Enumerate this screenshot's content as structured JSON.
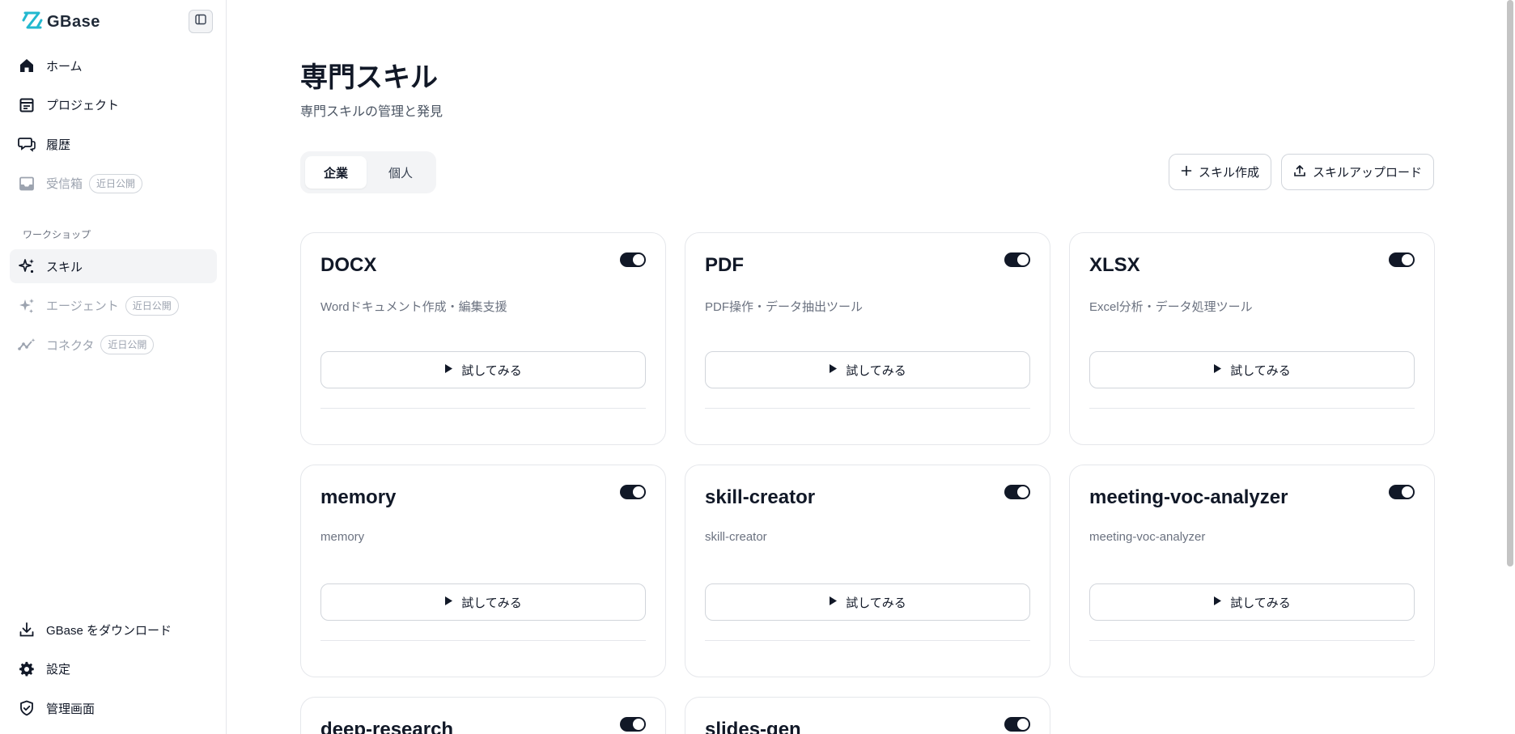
{
  "brand": {
    "name": "GBase"
  },
  "sidebar": {
    "items": [
      {
        "label": "ホーム",
        "icon": "home-icon"
      },
      {
        "label": "プロジェクト",
        "icon": "project-icon"
      },
      {
        "label": "履歴",
        "icon": "history-icon"
      },
      {
        "label": "受信箱",
        "icon": "inbox-icon",
        "badge": "近日公開"
      }
    ],
    "section_label": "ワークショップ",
    "workshop_items": [
      {
        "label": "スキル",
        "icon": "sparkles-icon"
      },
      {
        "label": "エージェント",
        "icon": "agent-icon",
        "badge": "近日公開"
      },
      {
        "label": "コネクタ",
        "icon": "connector-icon",
        "badge": "近日公開"
      }
    ],
    "bottom_items": [
      {
        "label": "GBase をダウンロード",
        "icon": "download-icon"
      },
      {
        "label": "設定",
        "icon": "gear-icon"
      },
      {
        "label": "管理画面",
        "icon": "shield-check-icon"
      }
    ]
  },
  "main": {
    "title": "専門スキル",
    "subtitle": "専門スキルの管理と発見",
    "tabs": [
      {
        "label": "企業"
      },
      {
        "label": "個人"
      }
    ],
    "actions": {
      "create_label": "スキル作成",
      "upload_label": "スキルアップロード"
    },
    "try_label": "試してみる",
    "cards": [
      {
        "title": "DOCX",
        "desc": "Wordドキュメント作成・編集支援",
        "enabled": true
      },
      {
        "title": "PDF",
        "desc": "PDF操作・データ抽出ツール",
        "enabled": true
      },
      {
        "title": "XLSX",
        "desc": "Excel分析・データ処理ツール",
        "enabled": true
      },
      {
        "title": "memory",
        "desc": "memory",
        "enabled": true
      },
      {
        "title": "skill-creator",
        "desc": "skill-creator",
        "enabled": true
      },
      {
        "title": "meeting-voc-analyzer",
        "desc": "meeting-voc-analyzer",
        "enabled": true
      },
      {
        "title": "deep-research",
        "desc": "",
        "enabled": true
      },
      {
        "title": "slides-gen",
        "desc": "",
        "enabled": true
      }
    ]
  },
  "colors": {
    "accent": "#111827",
    "brand": "#22b8cf",
    "muted": "#9ca3af"
  }
}
